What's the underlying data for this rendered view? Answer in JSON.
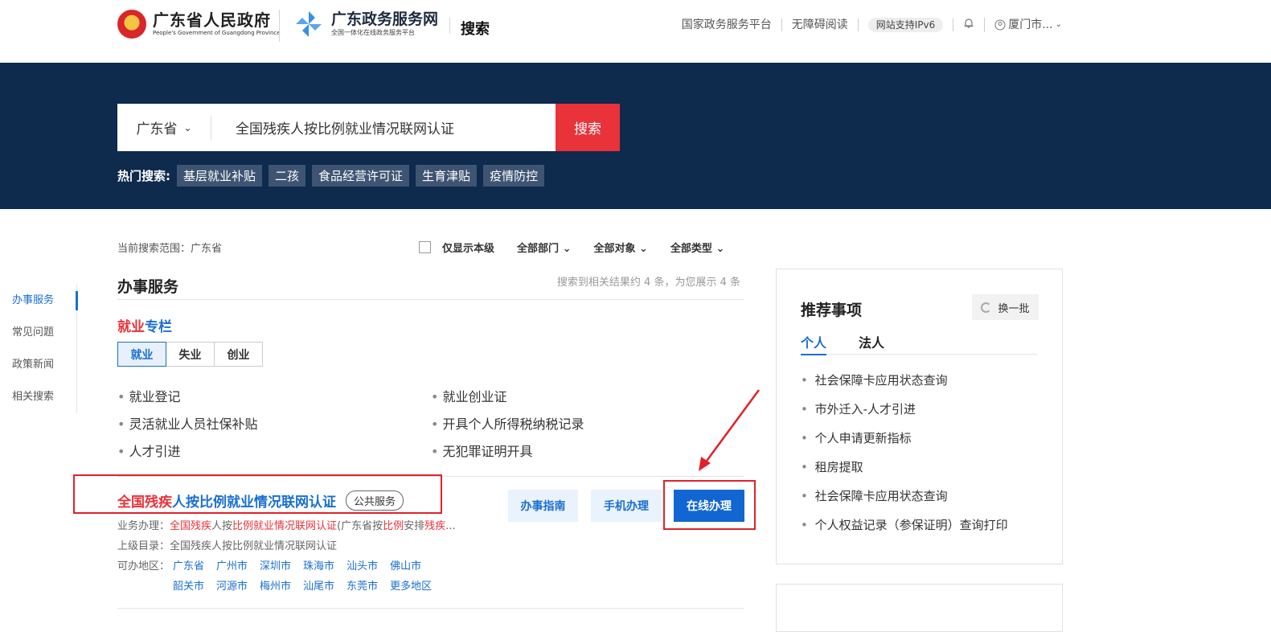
{
  "header": {
    "gov_name": "广东省人民政府",
    "gov_name_en": "People's Government of Guangdong Province",
    "portal_name": "广东政务服务网",
    "portal_sub": "全国一体化在线政务服务平台",
    "section": "搜索",
    "topnav": [
      "国家政务服务平台",
      "无障碍阅读",
      "网站支持IPv6"
    ],
    "user": "厦门市..."
  },
  "search": {
    "region": "广东省",
    "query": "全国残疾人按比例就业情况联网认证",
    "button": "搜索",
    "hot_label": "热门搜索:",
    "hot_tags": [
      "基层就业补贴",
      "二孩",
      "食品经营许可证",
      "生育津贴",
      "疫情防控"
    ]
  },
  "leftnav": [
    "办事服务",
    "常见问题",
    "政策新闻",
    "相关搜索"
  ],
  "filters": {
    "scope": "当前搜索范围：广东省",
    "only_this_level": "仅显示本级",
    "dept": "全部部门",
    "target": "全部对象",
    "type": "全部类型"
  },
  "main": {
    "title": "办事服务",
    "count": "搜索到相关结果约 4 条，为您展示 4 条",
    "column_title_a": "就业",
    "column_title_b": "专栏",
    "tabs": [
      "就业",
      "失业",
      "创业"
    ],
    "links": [
      "就业登记",
      "就业创业证",
      "灵活就业人员社保补贴",
      "开具个人所得税纳税记录",
      "人才引进",
      "无犯罪证明开具"
    ]
  },
  "result": {
    "title_red": "全国残疾",
    "title_blue": "人按比例就业情况联网认证",
    "badge": "公共服务",
    "btn_guide": "办事指南",
    "btn_mobile": "手机办理",
    "btn_online": "在线办理",
    "biz_label": "业务办理：",
    "biz_hl1": "全国残疾",
    "biz_t1": "人按",
    "biz_hl2": "比例就业情况联网认证",
    "biz_t2": "(广东省按",
    "biz_hl3": "比例",
    "biz_t3": "安排",
    "biz_hl4": "残疾",
    "biz_t4": "...",
    "parent_label": "上级目录：",
    "parent": "全国残疾人按比例就业情况联网认证",
    "area_label": "可办地区：",
    "areas_row1": [
      "广东省",
      "广州市",
      "深圳市",
      "珠海市",
      "汕头市",
      "佛山市"
    ],
    "areas_row2": [
      "韶关市",
      "河源市",
      "梅州市",
      "汕尾市",
      "东莞市",
      "更多地区"
    ]
  },
  "aside": {
    "title": "推荐事项",
    "swap": "换一批",
    "tabs": [
      "个人",
      "法人"
    ],
    "items": [
      "社会保障卡应用状态查询",
      "市外迁入-人才引进",
      "个人申请更新指标",
      "租房提取",
      "社会保障卡应用状态查询",
      "个人权益记录（参保证明）查询打印"
    ]
  },
  "colors": {
    "navy": "#0e2a4d",
    "red": "#e9323a",
    "blue": "#1a6fd1",
    "primary": "#1266d2"
  }
}
